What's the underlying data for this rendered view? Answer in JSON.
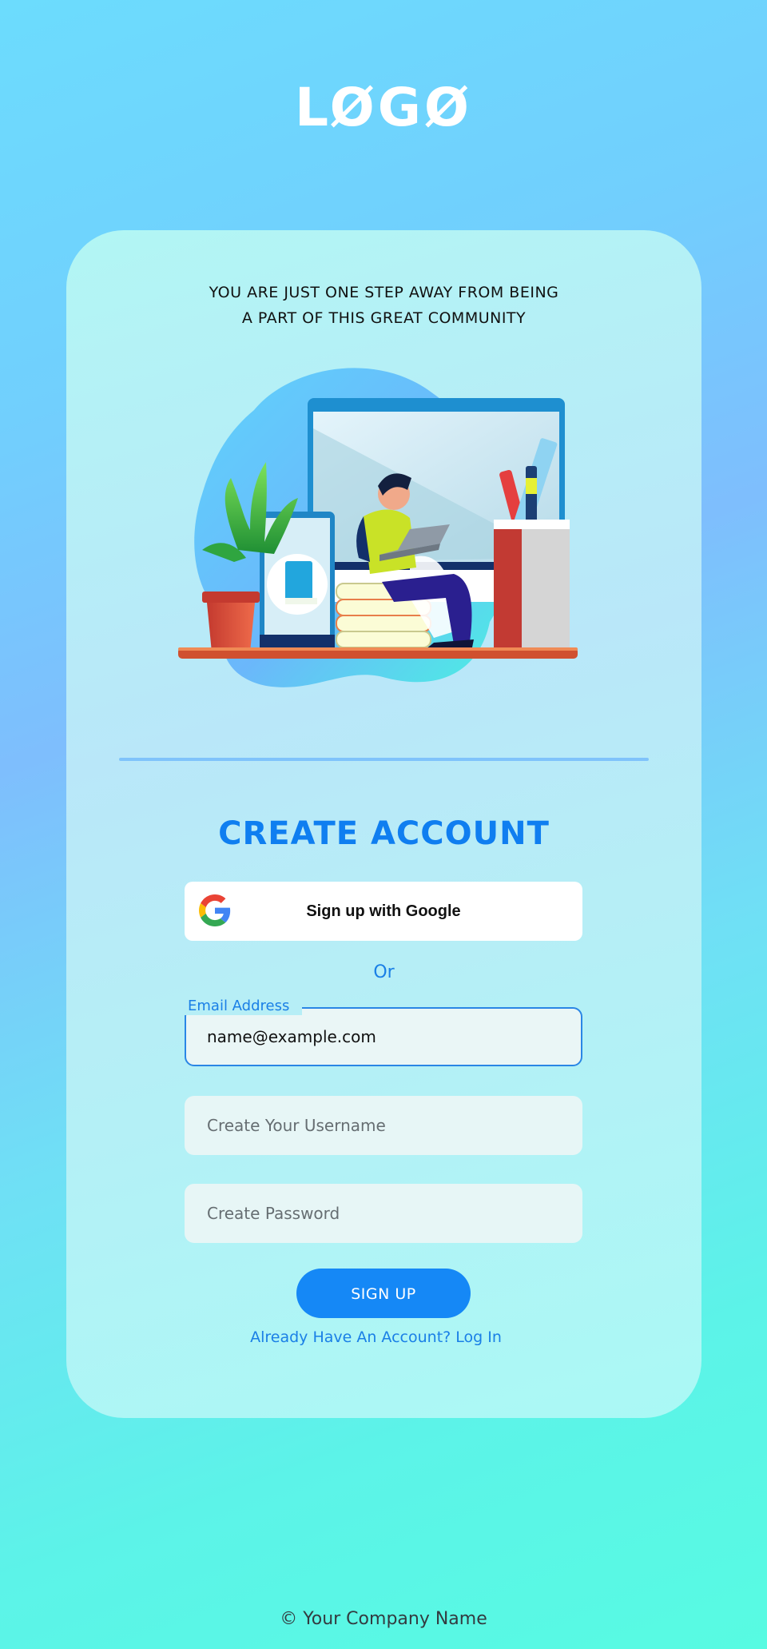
{
  "logo": {
    "text": "LØGØ"
  },
  "tagline": {
    "line1": "YOU ARE JUST ONE STEP AWAY FROM BEING",
    "line2": "A PART OF THIS GREAT COMMUNITY"
  },
  "form": {
    "heading": "CREATE ACCOUNT",
    "google_button_label": "Sign up with Google",
    "separator": "Or",
    "email": {
      "label": "Email Address",
      "value": "name@example.com"
    },
    "username": {
      "placeholder": "Create Your Username"
    },
    "password": {
      "placeholder": "Create Password"
    },
    "submit_label": "SIGN UP",
    "login_link": "Already Have An Account? Log In"
  },
  "footer": {
    "text": "© Your Company Name"
  },
  "colors": {
    "accent": "#0f7ef0",
    "button": "#1588f6",
    "card": "#b6eef6"
  },
  "icons": {
    "google": "google-g-icon",
    "illustration": "person-laptop-desk-illustration"
  }
}
